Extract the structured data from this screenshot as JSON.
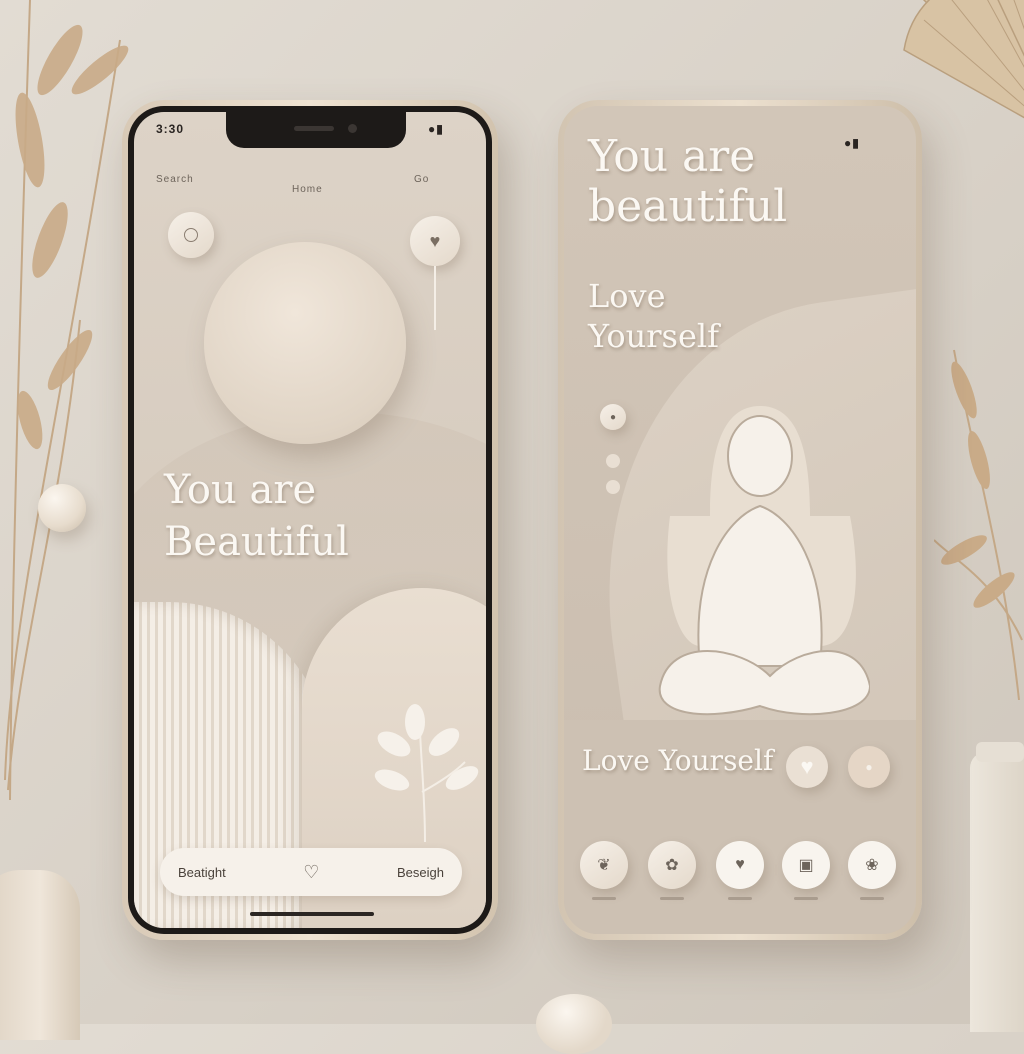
{
  "colors": {
    "background": "#ddd6cc",
    "accent_beige": "#d6cbbe",
    "text_light": "#fbf8f3",
    "frame_gold": "#e3d5c2"
  },
  "phone1": {
    "status_left": "3:30",
    "header_left": "Search",
    "header_center": "Home",
    "header_right": "Go",
    "left_button_icon": "circle-icon",
    "right_button_icon": "heart-icon",
    "headline_line1": "You are",
    "headline_line2": "Beautiful",
    "subline": "",
    "nav": {
      "left_label": "Beatight",
      "center_icon": "heart-icon",
      "right_label": "Beseigh"
    }
  },
  "phone2": {
    "headline_line1": "You are",
    "headline_line2": "beautiful",
    "sub_line1": "Love",
    "sub_line2": "Yourself",
    "bottom_title": "Love Yourself",
    "bottom_icons": [
      "heart-icon",
      "circle-icon"
    ],
    "dock_icons": [
      "swan-icon",
      "bird-icon",
      "heart-icon",
      "gift-icon",
      "lotus-icon"
    ]
  }
}
